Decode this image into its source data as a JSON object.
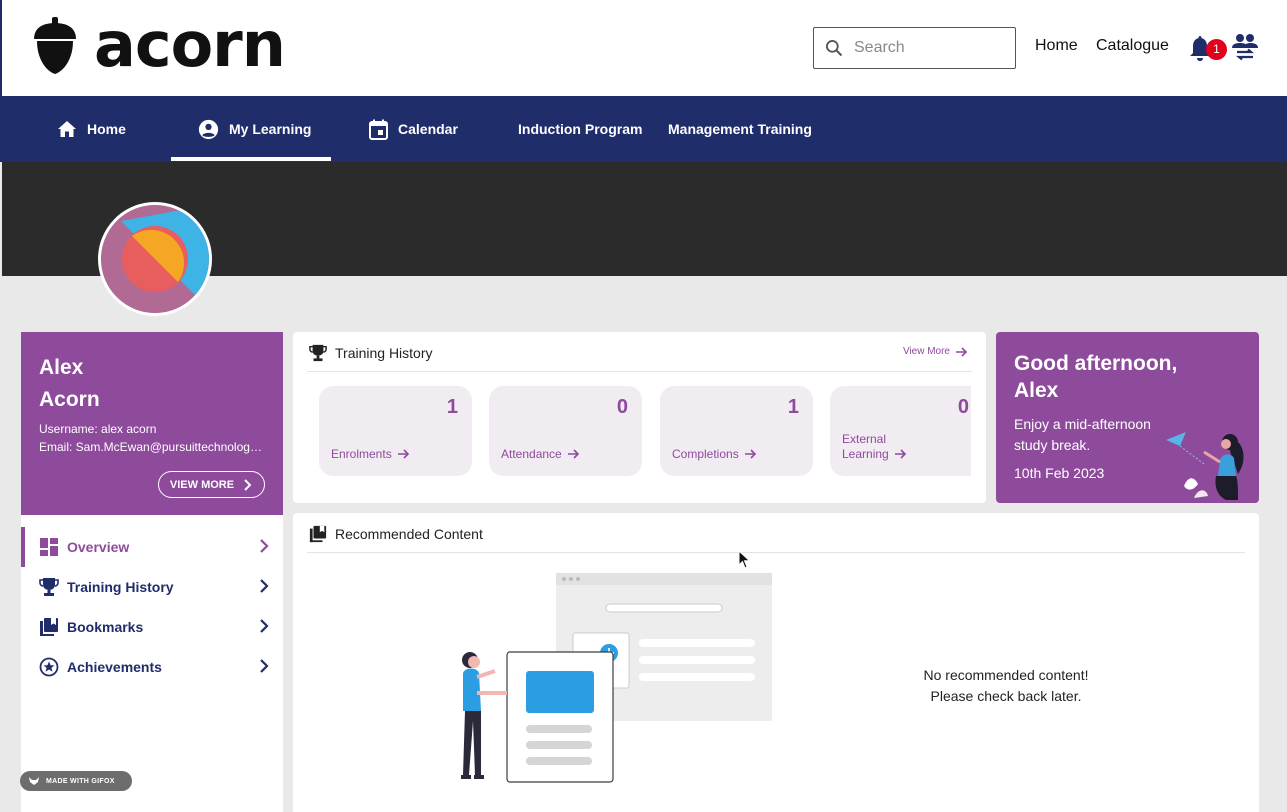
{
  "brand": {
    "name": "acorn",
    "icon": "acorn-logo-icon"
  },
  "header": {
    "search_placeholder": "Search",
    "links": [
      {
        "label": "Home"
      },
      {
        "label": "Catalogue"
      }
    ],
    "notification_count": "1"
  },
  "nav": {
    "items": [
      {
        "label": "Home",
        "icon": "home-icon"
      },
      {
        "label": "My Learning",
        "icon": "account-circle-icon",
        "active": true
      },
      {
        "label": "Calendar",
        "icon": "calendar-icon"
      },
      {
        "label": "Induction Program"
      },
      {
        "label": "Management Training"
      }
    ]
  },
  "profile": {
    "first_name": "Alex",
    "last_name": "Acorn",
    "username_line": "Username: alex acorn",
    "email_line": "Email: Sam.McEwan@pursuittechnology.com",
    "view_more": "VIEW MORE"
  },
  "sidemenu": {
    "items": [
      {
        "label": "Overview",
        "icon": "dashboard-icon",
        "active": true
      },
      {
        "label": "Training History",
        "icon": "trophy-icon"
      },
      {
        "label": "Bookmarks",
        "icon": "bookmarks-icon"
      },
      {
        "label": "Achievements",
        "icon": "star-circle-icon"
      }
    ]
  },
  "training_history": {
    "title": "Training History",
    "view_more": "View More",
    "stats": [
      {
        "value": "1",
        "label": "Enrolments"
      },
      {
        "value": "0",
        "label": "Attendance"
      },
      {
        "value": "1",
        "label": "Completions"
      },
      {
        "value": "0",
        "label_line1": "External",
        "label_line2": "Learning"
      }
    ]
  },
  "greeting": {
    "title": "Good afternoon, Alex",
    "message": "Enjoy a mid-afternoon study break.",
    "date": "10th Feb 2023"
  },
  "recommended": {
    "title": "Recommended Content",
    "empty_line1": "No recommended content!",
    "empty_line2": "Please check back later."
  },
  "watermark": "MADE WITH GIFOX",
  "colors": {
    "navy": "#1f2d6b",
    "purple": "#8e4a9b",
    "banner": "#2b2b2b",
    "badge": "#e4001b"
  }
}
